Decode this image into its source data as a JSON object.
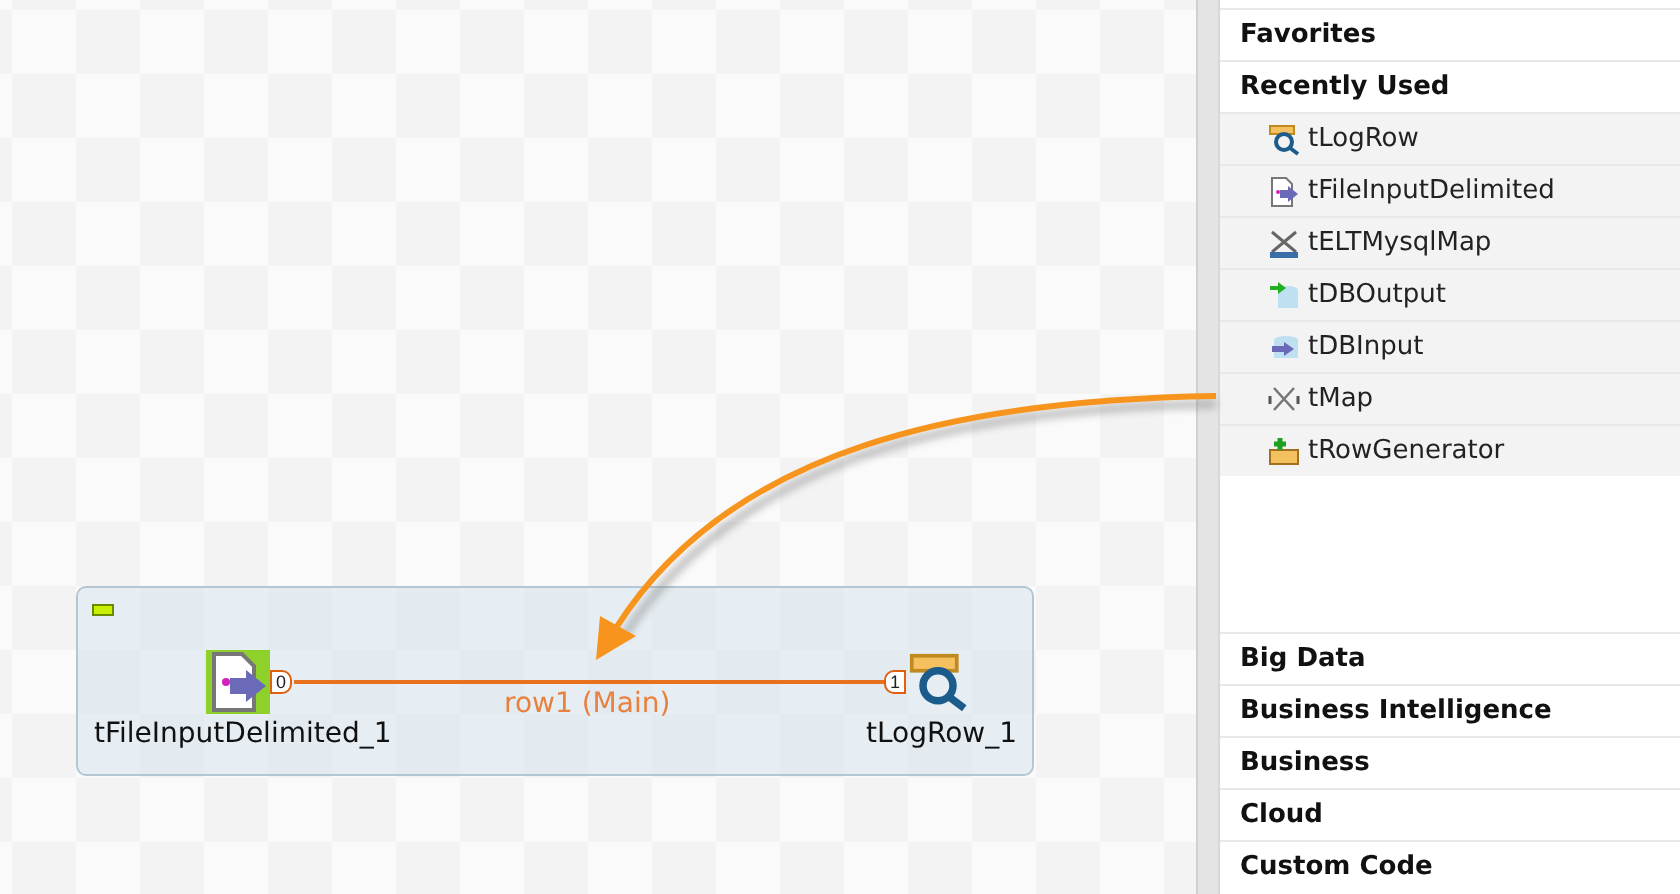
{
  "canvas": {
    "subjob": {
      "expanded": true
    },
    "components": [
      {
        "label": "tFileInputDelimited_1",
        "kind": "file-input"
      },
      {
        "label": "tLogRow_1",
        "kind": "log"
      }
    ],
    "connection": {
      "label": "row1 (Main)",
      "out_port": "0",
      "in_port": "1"
    }
  },
  "palette": {
    "top_sections": [
      {
        "label": "Favorites"
      },
      {
        "label": "Recently Used",
        "items": [
          {
            "label": "tLogRow",
            "kind": "log"
          },
          {
            "label": "tFileInputDelimited",
            "kind": "file-input"
          },
          {
            "label": "tELTMysqlMap",
            "kind": "elt-map"
          },
          {
            "label": "tDBOutput",
            "kind": "db-output"
          },
          {
            "label": "tDBInput",
            "kind": "db-input"
          },
          {
            "label": "tMap",
            "kind": "map"
          },
          {
            "label": "tRowGenerator",
            "kind": "row-generator"
          }
        ]
      }
    ],
    "categories": [
      {
        "label": "Big Data"
      },
      {
        "label": "Business Intelligence"
      },
      {
        "label": "Business"
      },
      {
        "label": "Cloud"
      },
      {
        "label": "Custom Code"
      }
    ]
  }
}
